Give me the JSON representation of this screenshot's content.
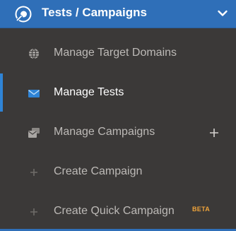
{
  "header": {
    "title": "Tests / Campaigns",
    "logo_icon": "target-shield-icon",
    "toggle_icon": "chevron-down-icon",
    "accent_color": "#2f6fb8"
  },
  "menu": {
    "items": [
      {
        "label": "Manage Target Domains",
        "icon": "globe-icon",
        "active": false
      },
      {
        "label": "Manage Tests",
        "icon": "envelope-icon",
        "active": true
      },
      {
        "label": "Manage Campaigns",
        "icon": "campaigns-icon",
        "active": false,
        "action_icon": "plus-icon"
      },
      {
        "label": "Create Campaign",
        "icon": "plus-icon",
        "active": false
      },
      {
        "label": "Create Quick Campaign",
        "icon": "plus-icon",
        "active": false,
        "badge": "BETA"
      }
    ]
  },
  "colors": {
    "background": "#3b3938",
    "active_indicator": "#2f84d6",
    "text": "#bdbab7",
    "active_text": "#ffffff",
    "badge": "#f0a43a"
  }
}
